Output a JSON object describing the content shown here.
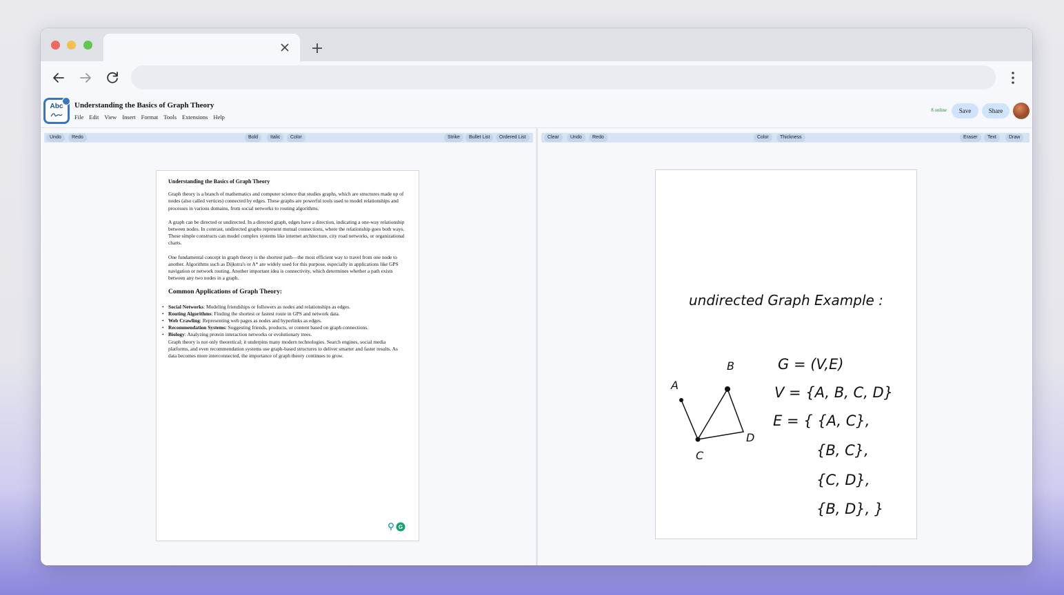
{
  "browser": {
    "tab_title": "",
    "url": ""
  },
  "app": {
    "doc_title": "Understanding the Basics of Graph Theory",
    "logo_text": "Abc",
    "menu": [
      "File",
      "Edit",
      "View",
      "Insert",
      "Format",
      "Tools",
      "Extensions",
      "Help"
    ],
    "online_status": "8 online",
    "save_label": "Save",
    "share_label": "Share"
  },
  "editor_toolbar": {
    "undo": "Undo",
    "redo": "Redo",
    "bold": "Bold",
    "italic": "Italic",
    "color": "Color",
    "strike": "Strike",
    "bullet_list": "Bullet List",
    "ordered_list": "Ordered List"
  },
  "canvas_toolbar": {
    "clear": "Clear",
    "undo": "Undo",
    "redo": "Redo",
    "color": "Color",
    "thickness": "Thickness",
    "eraser": "Eraser",
    "text": "Text",
    "draw": "Draw"
  },
  "document": {
    "heading": "Understanding the Basics of Graph Theory",
    "p1": "Graph theory is a branch of mathematics and computer science that studies graphs, which are structures made up of nodes (also called vertices) connected by edges. These graphs are powerful tools used to model relationships and processes in various domains, from social networks to routing algorithms.",
    "p2": "A graph can be directed or undirected. In a directed graph, edges have a direction, indicating a one-way relationship between nodes. In contrast, undirected graphs represent mutual connections, where the relationship goes both ways. These simple constructs can model complex systems like internet architecture, city road networks, or organizational charts.",
    "p3": "One fundamental concept in graph theory is the shortest path—the most efficient way to travel from one node to another. Algorithms such as Dijkstra's or A* are widely used for this purpose, especially in applications like GPS navigation or network routing. Another important idea is connectivity, which determines whether a path exists between any two nodes in a graph.",
    "subheading": "Common Applications of Graph Theory:",
    "applications": [
      {
        "term": "Social Networks",
        "desc": ": Modeling friendships or followers as nodes and relationships as edges."
      },
      {
        "term": "Routing Algorithms",
        "desc": ": Finding the shortest or fastest route in GPS and network data."
      },
      {
        "term": "Web Crawling",
        "desc": ": Representing web pages as nodes and hyperlinks as edges."
      },
      {
        "term": "Recommendation Systems",
        "desc": ": Suggesting friends, products, or content based on graph connections."
      },
      {
        "term": "Biology",
        "desc": ": Analyzing protein interaction networks or evolutionary trees."
      }
    ],
    "closing": "Graph theory is not only theoretical; it underpins many modern technologies. Search engines, social media platforms, and even recommendation systems use graph-based structures to deliver smarter and faster results. As data becomes more interconnected, the importance of graph theory continues to grow."
  },
  "drawing": {
    "title": "undirected Graph Example :",
    "nodes": [
      "A",
      "B",
      "C",
      "D"
    ],
    "def_g": "G = (V,E)",
    "def_v": "V = {A, B, C, D}",
    "def_e": [
      "E = { {A, C},",
      "{B, C},",
      "{C, D},",
      "{B, D},  }"
    ]
  },
  "colors": {
    "accent": "#cfe4fb",
    "online": "#1c8a2a",
    "toolbar": "#d5e3f3"
  }
}
